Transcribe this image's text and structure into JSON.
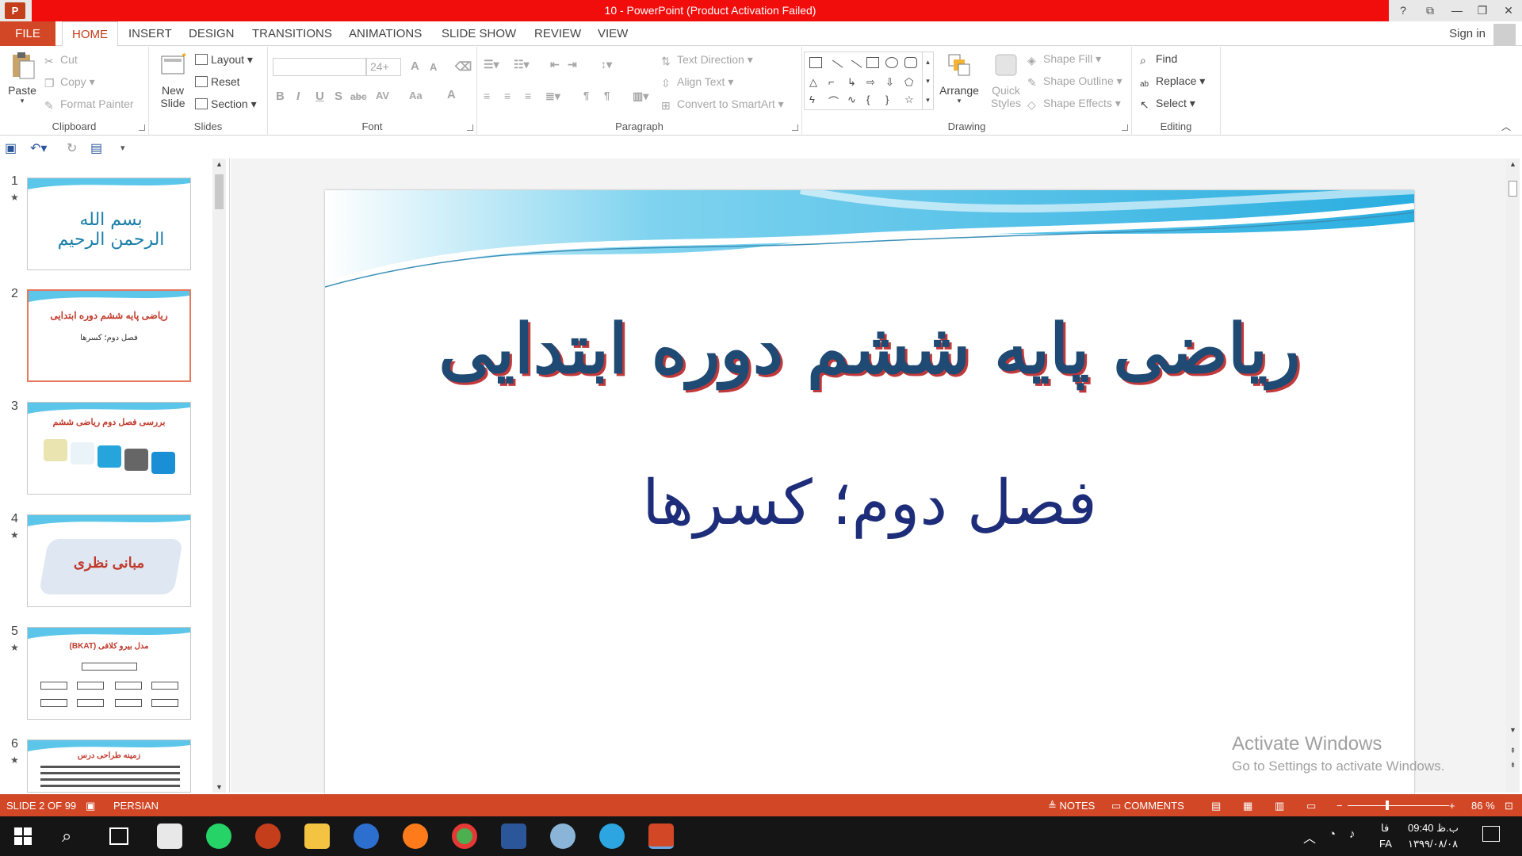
{
  "titlebar": {
    "app_icon_text": "P",
    "title": "10 - PowerPoint (Product Activation Failed)",
    "help": "?",
    "ribbon_display": "⧉",
    "minimize": "—",
    "restore": "❐",
    "close": "✕"
  },
  "tabs": {
    "file": "FILE",
    "items": [
      "HOME",
      "INSERT",
      "DESIGN",
      "TRANSITIONS",
      "ANIMATIONS",
      "SLIDE SHOW",
      "REVIEW",
      "VIEW"
    ],
    "sign_in": "Sign in"
  },
  "ribbon": {
    "clipboard": {
      "label": "Clipboard",
      "paste": "Paste",
      "cut": "Cut",
      "copy": "Copy",
      "format_painter": "Format Painter"
    },
    "slides": {
      "label": "Slides",
      "new_slide_line1": "New",
      "new_slide_line2": "Slide",
      "layout": "Layout",
      "reset": "Reset",
      "section": "Section"
    },
    "font": {
      "label": "Font",
      "size": "24+",
      "grow": "A",
      "shrink": "A",
      "bold": "B",
      "italic": "I",
      "underline": "U",
      "shadow": "S",
      "strike": "abc",
      "spacing": "AV",
      "case": "Aa",
      "color": "A"
    },
    "paragraph": {
      "label": "Paragraph",
      "text_direction": "Text Direction",
      "align_text": "Align Text",
      "convert_smartart": "Convert to SmartArt"
    },
    "drawing": {
      "label": "Drawing",
      "arrange": "Arrange",
      "quick_styles_line1": "Quick",
      "quick_styles_line2": "Styles",
      "shape_fill": "Shape Fill",
      "shape_outline": "Shape Outline",
      "shape_effects": "Shape Effects"
    },
    "editing": {
      "label": "Editing",
      "find": "Find",
      "replace": "Replace",
      "select": "Select"
    }
  },
  "thumbnails": [
    {
      "num": "1",
      "star": true,
      "text": "بسم الله الرحمن الرحیم"
    },
    {
      "num": "2",
      "star": false,
      "text": "ریاضی پایه ششم دوره ابتدایی",
      "sub": "فصل دوم؛ کسرها"
    },
    {
      "num": "3",
      "star": false,
      "text": "بررسی فصل دوم ریاضی ششم"
    },
    {
      "num": "4",
      "star": true,
      "text": "مبانی نظری"
    },
    {
      "num": "5",
      "star": true,
      "text": "مدل بیرو کلافی (BKAT)"
    },
    {
      "num": "6",
      "star": true,
      "text": "زمینه طراحی درس"
    }
  ],
  "slide": {
    "title": "ریاضی پایه ششم دوره ابتدایی",
    "subtitle": "فصل دوم؛ کسرها"
  },
  "watermark": {
    "line1": "Activate Windows",
    "line2": "Go to Settings to activate Windows."
  },
  "status": {
    "slide_info": "SLIDE 2 OF 99",
    "language": "PERSIAN",
    "notes": "NOTES",
    "comments": "COMMENTS",
    "zoom": "86 %"
  },
  "taskbar": {
    "lang_line1": "فا",
    "lang_line2": "FA",
    "time": "09:40 ب.ظ",
    "date": "۱۳۹۹/۰۸/۰۸"
  },
  "colors": {
    "accent": "#d24726",
    "title_red": "#f20d0d",
    "slide_title": "#1f4a73",
    "slide_sub": "#1e2d7a"
  }
}
